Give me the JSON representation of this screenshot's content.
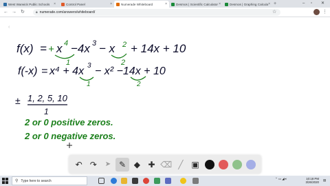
{
  "browser": {
    "tabs": [
      {
        "label": "West Warwick Public Schools",
        "favicon_color": "#2e6da4",
        "active": false
      },
      {
        "label": "Control Panel",
        "favicon_color": "#e05b2b",
        "active": false
      },
      {
        "label": "Numerade Whiteboard",
        "favicon_color": "#e06b00",
        "active": true
      },
      {
        "label": "Desmos | Scientific Calculator",
        "favicon_color": "#1b8a3a",
        "active": false
      },
      {
        "label": "Desmos | Graphing Calculator",
        "favicon_color": "#1b8a3a",
        "active": false
      }
    ],
    "url": "numerade.com/answers/whiteboard/"
  },
  "whiteboard": {
    "line1": {
      "f": "f(x)",
      "eq": "=",
      "plus": "+",
      "t1": "x",
      "e1": "4",
      "t2": "−4x",
      "e2": "3",
      "t3": "− x",
      "e3": "2",
      "rest": "+ 14x + 10",
      "mark1": "1",
      "mark2": "2"
    },
    "line2": {
      "f": "f(-x)",
      "eq": "=",
      "t1": "x⁴ + 4x",
      "e2": "3",
      "t3": "− x² −14x + 10",
      "mark1": "1",
      "mark2": "2"
    },
    "rational": {
      "pm": "±",
      "numer": "1, 2, 5, 10",
      "denom": "1"
    },
    "notes": [
      "2  or  0  positive zeros.",
      "2  or  0  negative zeros."
    ],
    "colors": {
      "ink": "#0a0a28",
      "green": "#1a7f1a",
      "cursor": "#222222"
    }
  },
  "drawing_tools": [
    {
      "name": "undo-icon",
      "glyph": "↶"
    },
    {
      "name": "redo-icon",
      "glyph": "↷"
    },
    {
      "name": "select-pointer-icon",
      "glyph": "➤"
    },
    {
      "name": "pen-icon",
      "glyph": "✎"
    },
    {
      "name": "shapes-icon",
      "glyph": "◆"
    },
    {
      "name": "add-icon",
      "glyph": "✚"
    },
    {
      "name": "eraser-icon",
      "glyph": "⌫"
    },
    {
      "name": "line-icon",
      "glyph": "╱"
    },
    {
      "name": "image-icon",
      "glyph": "▣"
    }
  ],
  "swatches": [
    {
      "name": "black-swatch",
      "color": "#111111"
    },
    {
      "name": "red-swatch",
      "color": "#e25b5b"
    },
    {
      "name": "green-swatch",
      "color": "#8fc28b"
    },
    {
      "name": "blue-swatch",
      "color": "#a4aee6"
    }
  ],
  "taskbar": {
    "search_placeholder": "Type here to search",
    "time": "10:18 PM",
    "date": "3/26/2020"
  }
}
